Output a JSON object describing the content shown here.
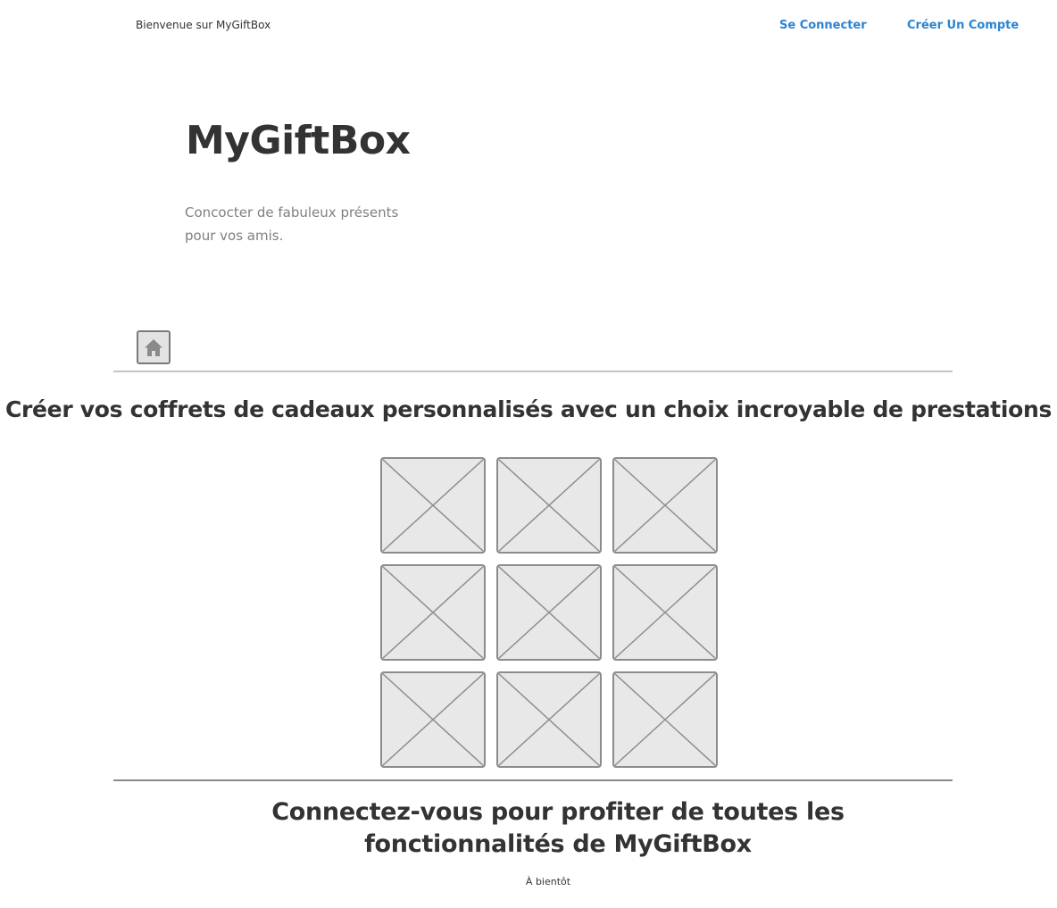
{
  "header": {
    "welcome_text": "Bienvenue sur MyGiftBox",
    "login_label": "Se Connecter",
    "signup_label": "Créer Un Compte",
    "link_color": "#2b84d1"
  },
  "hero": {
    "title": "MyGiftBox",
    "tagline": "Concocter de fabuleux présents pour vos amis."
  },
  "toolbar": {
    "home_icon": "home-icon"
  },
  "main": {
    "headline": "Créer vos coffrets de cadeaux personnalisés avec un choix incroyable de prestations",
    "gallery": {
      "placeholder_icon": "image-placeholder-icon",
      "count": 9
    }
  },
  "cta": {
    "text": "Connectez-vous pour profiter de toutes les fonctionnalités de MyGiftBox"
  },
  "footer": {
    "note": "À bientôt"
  }
}
